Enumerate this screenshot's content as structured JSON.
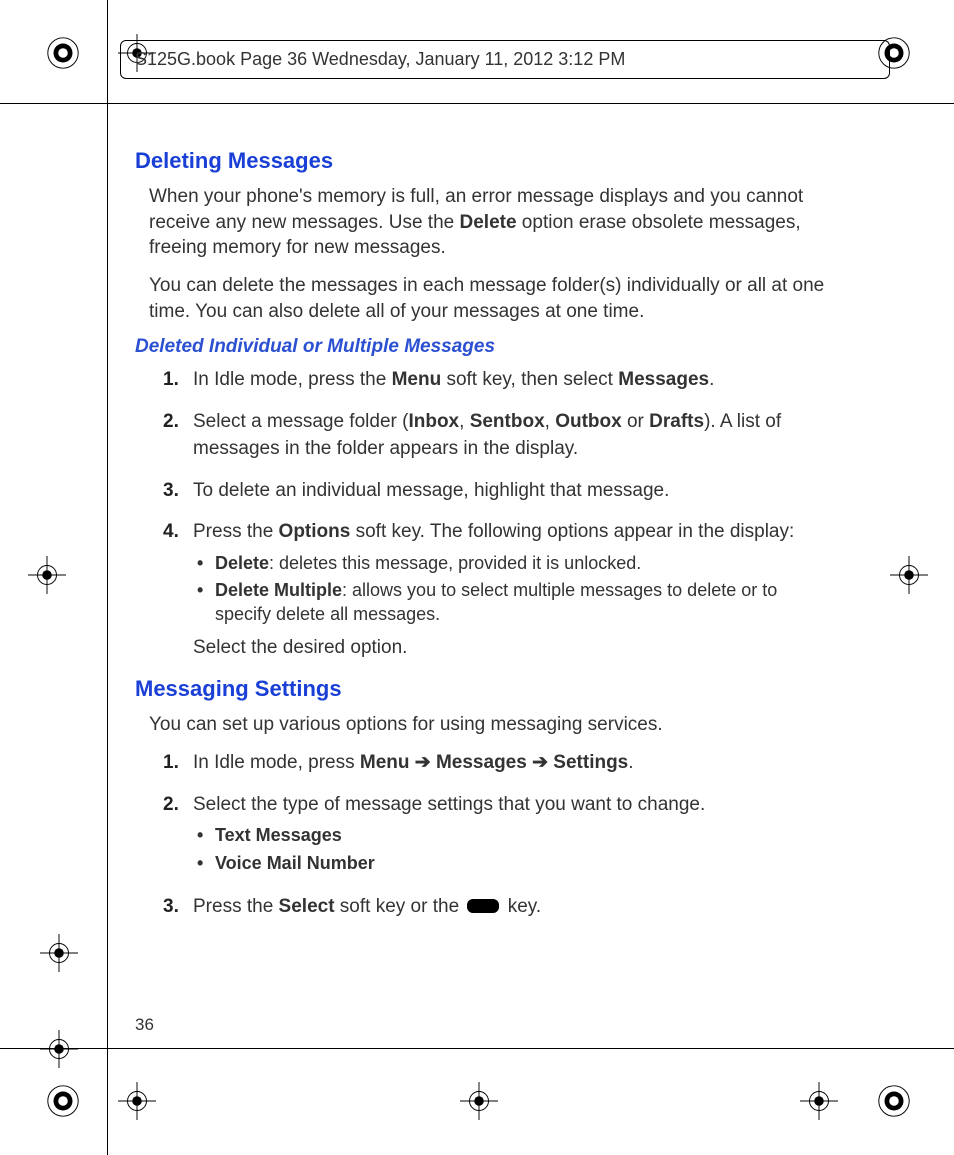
{
  "header": "S125G.book  Page 36  Wednesday, January 11, 2012  3:12 PM",
  "page_number": "36",
  "s1": {
    "title": "Deleting Messages",
    "p1a": "When your phone's memory is full, an error message displays and you cannot receive any new messages. Use the ",
    "p1b": "Delete",
    "p1c": " option erase obsolete messages, freeing memory for new messages.",
    "p2": "You can delete the messages in each message folder(s) individually or all at one time. You can also delete all of your messages at one time.",
    "sub_title": "Deleted Individual or Multiple Messages",
    "steps": {
      "n1": "1.",
      "s1a": "In Idle mode, press the ",
      "s1b": "Menu",
      "s1c": " soft key, then select ",
      "s1d": "Messages",
      "s1e": ".",
      "n2": "2.",
      "s2a": "Select a message folder (",
      "s2b": "Inbox",
      "s2c": ", ",
      "s2d": "Sentbox",
      "s2e": ", ",
      "s2f": "Outbox",
      "s2g": " or ",
      "s2h": "Drafts",
      "s2i": "). A list of messages in the folder appears in the display.",
      "n3": "3.",
      "s3": "To delete an individual message, highlight that message.",
      "n4": "4.",
      "s4a": "Press the ",
      "s4b": "Options",
      "s4c": " soft key. The following options appear in the display:",
      "b1a": "Delete",
      "b1b": ": deletes this message, provided it is unlocked.",
      "b2a": "Delete Multiple",
      "b2b": ": allows you to select multiple messages to delete or to specify delete all messages.",
      "tail": "Select the desired option."
    }
  },
  "s2": {
    "title": "Messaging Settings",
    "p1": "You can set up various options for using messaging services.",
    "steps": {
      "n1": "1.",
      "s1a": "In Idle mode, press ",
      "s1b": "Menu",
      "s1c": "  ➔ ",
      "s1d": "Messages",
      "s1e": " ➔ ",
      "s1f": "Settings",
      "s1g": ".",
      "n2": "2.",
      "s2": "Select the type of message settings that you want to change.",
      "b1": "Text Messages",
      "b2": "Voice Mail Number",
      "n3": "3.",
      "s3a": "Press the ",
      "s3b": "Select",
      "s3c": " soft key or the ",
      "s3d": " key."
    }
  }
}
